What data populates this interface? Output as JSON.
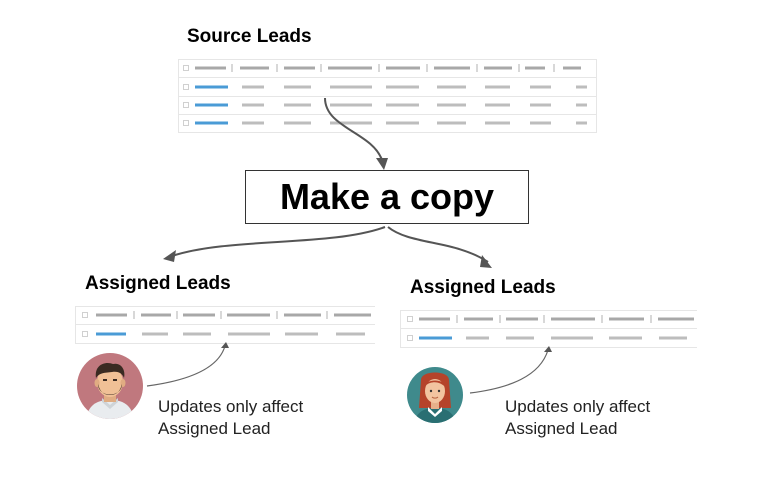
{
  "source": {
    "title": "Source Leads"
  },
  "action": {
    "label": "Make a copy"
  },
  "left": {
    "title": "Assigned Leads",
    "note_line1": "Updates only affect",
    "note_line2": "Assigned Lead"
  },
  "right": {
    "title": "Assigned Leads",
    "note_line1": "Updates only affect",
    "note_line2": "Assigned Lead"
  },
  "colors": {
    "highlight_bar": "#4a9bd6",
    "placeholder_bar": "#bdbdbd",
    "header_bar": "#a8a8a8",
    "grid_line": "#e6e6e6",
    "arrow": "#555555",
    "avatar_left_bg": "#c0787e",
    "avatar_right_bg": "#3f8a8c"
  }
}
